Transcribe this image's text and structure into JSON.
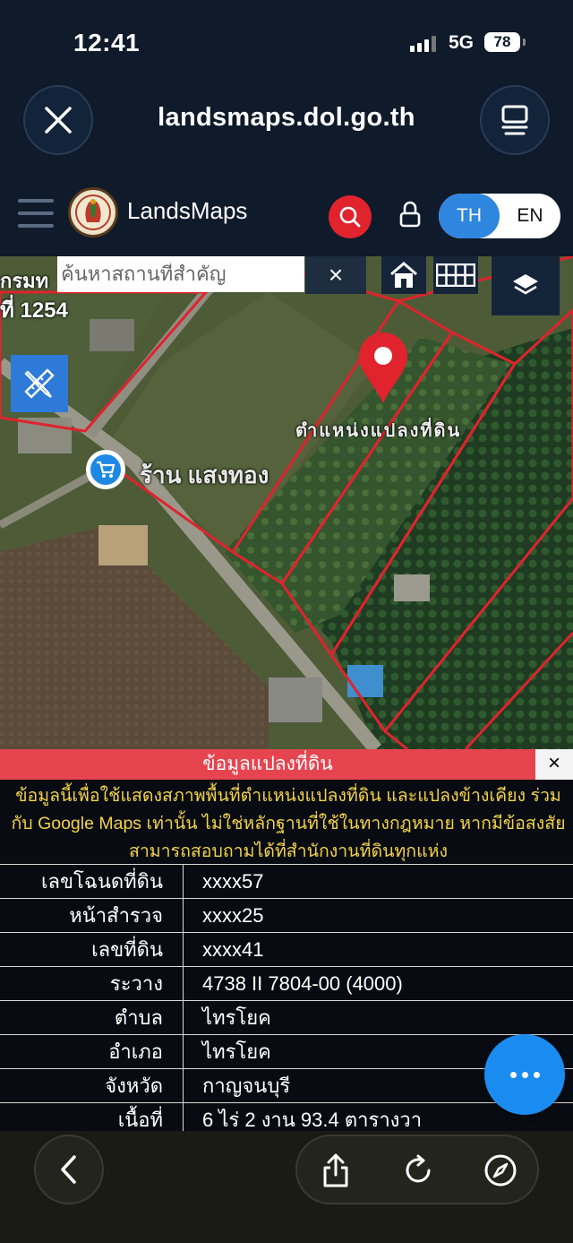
{
  "status": {
    "time": "12:41",
    "network": "5G",
    "battery": "78"
  },
  "browser": {
    "url": "landsmaps.dol.go.th"
  },
  "header": {
    "brand": "LandsMaps",
    "lang_th": "TH",
    "lang_en": "EN"
  },
  "map": {
    "search_placeholder": "ค้นหาสถานที่สำคัญ",
    "clear_label": "×",
    "top_left_label_1": "กรมท",
    "top_left_label_2": "ที่ 1254",
    "parcel_label": "ตำแหน่งแปลงที่ดิน",
    "shop_label": "ร้าน แสงทอง"
  },
  "panel": {
    "title": "ข้อมูลแปลงที่ดิน",
    "close_label": "×",
    "note": "ข้อมูลนี้เพื่อใช้แสดงสภาพพื้นที่ตำแหน่งแปลงที่ดิน และแปลงข้างเคียง ร่วมกับ Google Maps เท่านั้น ไม่ใช่หลักฐานที่ใช้ในทางกฎหมาย หากมีข้อสงสัยสามารถสอบถามได้ที่สำนักงานที่ดินทุกแห่ง",
    "rows": [
      {
        "key": "เลขโฉนดที่ดิน",
        "value": "xxxx57"
      },
      {
        "key": "หน้าสำรวจ",
        "value": "xxxx25"
      },
      {
        "key": "เลขที่ดิน",
        "value": "xxxx41"
      },
      {
        "key": "ระวาง",
        "value": "4738 II 7804-00 (4000)"
      },
      {
        "key": "ตำบล",
        "value": "ไทรโยค"
      },
      {
        "key": "อำเภอ",
        "value": "ไทรโยค"
      },
      {
        "key": "จังหวัด",
        "value": "กาญจนบุรี"
      },
      {
        "key": "เนื้อที่",
        "value": "6 ไร่ 2 งาน 93.4 ตารางวา"
      }
    ]
  },
  "icons": {
    "close": "close-icon",
    "tabs": "tabs-icon",
    "menu": "menu-icon",
    "search": "search-icon",
    "lock": "lock-icon",
    "home": "home-icon",
    "grid": "grid-icon",
    "layers": "layers-icon",
    "draw": "ruler-pencil-icon",
    "pin": "map-pin-icon",
    "cart": "cart-icon",
    "more": "more-icon",
    "back": "chevron-left-icon",
    "share": "share-icon",
    "reload": "reload-icon",
    "compass": "compass-icon"
  },
  "colors": {
    "accent": "#2e86de",
    "danger": "#e0232d",
    "panel_title": "#e64550",
    "note_text": "#f3d14a",
    "parcel_border": "#e0232d"
  }
}
